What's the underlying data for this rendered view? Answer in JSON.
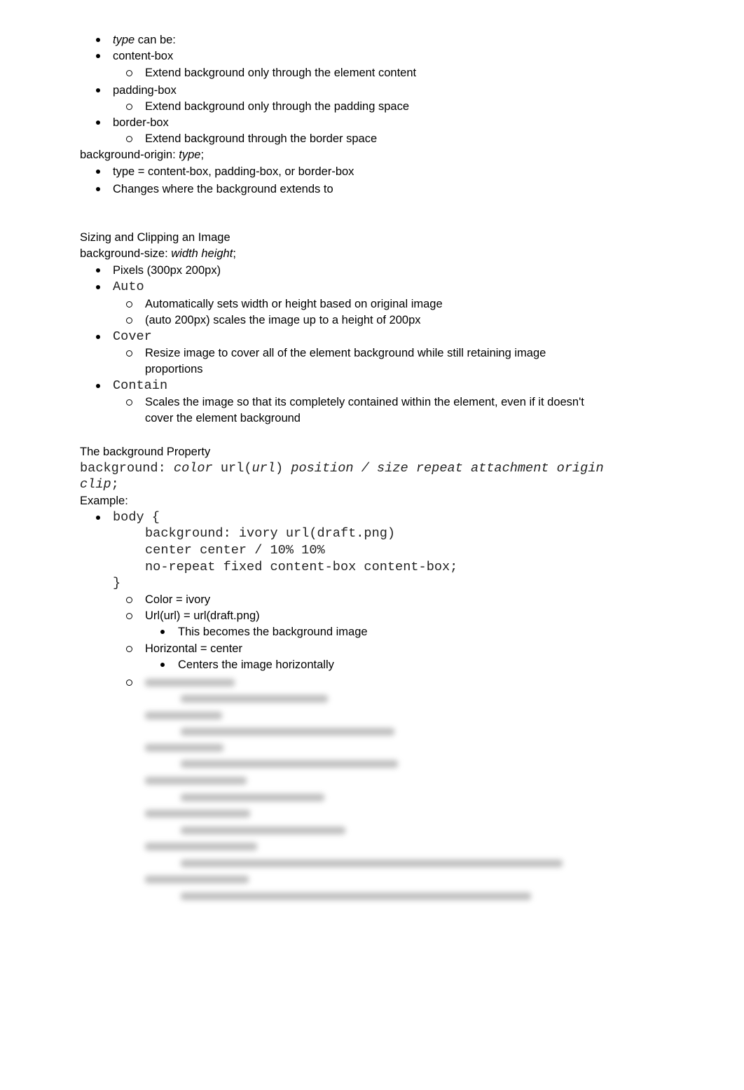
{
  "section1": {
    "type_can_be": {
      "italic": "type",
      "rest": " can be:"
    },
    "items": [
      {
        "label": "content-box",
        "desc": "Extend background only through the element content"
      },
      {
        "label": "padding-box",
        "desc": "Extend background only through the padding space"
      },
      {
        "label": "border-box",
        "desc": "Extend background through the border space"
      }
    ],
    "origin_prefix": "background-origin: ",
    "origin_italic": "type",
    "origin_suffix": ";",
    "origin_bullets": [
      "type = content-box, padding-box, or border-box",
      "Changes where the background extends to"
    ]
  },
  "section2": {
    "heading": "Sizing and Clipping an Image",
    "size_prefix": "background-size: ",
    "size_italic": "width height",
    "size_suffix": ";",
    "pixels": "Pixels (300px 200px)",
    "auto": "Auto",
    "auto_desc": [
      "Automatically sets width or height based on original image",
      "(auto 200px) scales the image up to a height of 200px"
    ],
    "cover": "Cover",
    "cover_desc": [
      "Resize image to cover all of the element background while still retaining image",
      "proportions"
    ],
    "contain": "Contain",
    "contain_desc": [
      "Scales the image so that its completely contained within the element, even if it doesn't",
      "cover the element background"
    ]
  },
  "section3": {
    "heading": "The background Property",
    "syntax": {
      "a": "background: ",
      "b": "color",
      "c": " url(",
      "d": "url",
      "e": ") ",
      "f": "position / size repeat attachment origin",
      "g": "clip",
      "h": ";"
    },
    "example_label": "Example:",
    "code": [
      "body {",
      "background: ivory url(draft.png)",
      "center center / 10% 10%",
      "no-repeat fixed content-box content-box;",
      "}"
    ],
    "notes": [
      {
        "text": "Color = ivory"
      },
      {
        "text": "Url(url) = url(draft.png)",
        "sub": "This becomes the background image"
      },
      {
        "text": "Horizontal = center",
        "sub": "Centers the image horizontally"
      }
    ]
  }
}
